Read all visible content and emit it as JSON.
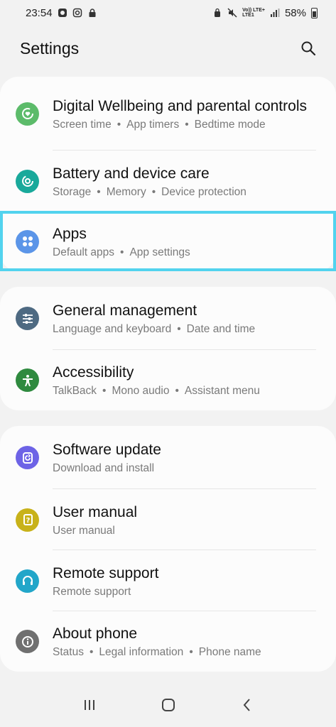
{
  "status_bar": {
    "time": "23:54",
    "network_top": "Vo)) LTE+",
    "network_bottom": "LTE1",
    "battery": "58%"
  },
  "header": {
    "title": "Settings"
  },
  "groups": [
    {
      "items": [
        {
          "title": "Digital Wellbeing and parental controls",
          "subs": [
            "Screen time",
            "App timers",
            "Bedtime mode"
          ],
          "icon": "digital-wellbeing-icon",
          "color": "#5cbb6a"
        },
        {
          "title": "Battery and device care",
          "subs": [
            "Storage",
            "Memory",
            "Device protection"
          ],
          "icon": "device-care-icon",
          "color": "#19a99b"
        },
        {
          "title": "Apps",
          "subs": [
            "Default apps",
            "App settings"
          ],
          "icon": "apps-icon",
          "color": "#5b95e8"
        }
      ]
    },
    {
      "items": [
        {
          "title": "General management",
          "subs": [
            "Language and keyboard",
            "Date and time"
          ],
          "icon": "general-management-icon",
          "color": "#4e6a82"
        },
        {
          "title": "Accessibility",
          "subs": [
            "TalkBack",
            "Mono audio",
            "Assistant menu"
          ],
          "icon": "accessibility-icon",
          "color": "#2f8a3f"
        }
      ]
    },
    {
      "items": [
        {
          "title": "Software update",
          "subs": [
            "Download and install"
          ],
          "icon": "software-update-icon",
          "color": "#6d63e6"
        },
        {
          "title": "User manual",
          "subs": [
            "User manual"
          ],
          "icon": "user-manual-icon",
          "color": "#c8b21a"
        },
        {
          "title": "Remote support",
          "subs": [
            "Remote support"
          ],
          "icon": "remote-support-icon",
          "color": "#22a6c9"
        },
        {
          "title": "About phone",
          "subs": [
            "Status",
            "Legal information",
            "Phone name"
          ],
          "icon": "about-phone-icon",
          "color": "#707070"
        }
      ]
    }
  ],
  "highlight_color": "#52d3ee",
  "navbar": {
    "recents_icon": "recents-icon",
    "home_icon": "home-icon",
    "back_icon": "back-icon"
  }
}
